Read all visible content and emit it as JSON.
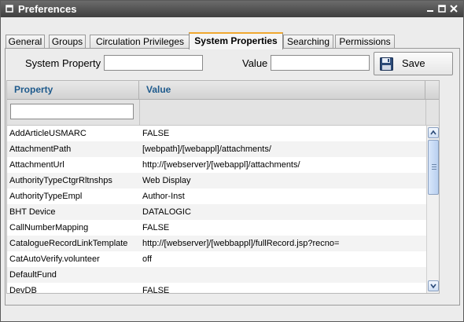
{
  "window": {
    "title": "Preferences"
  },
  "tabs": [
    {
      "label": "General"
    },
    {
      "label": "Groups"
    },
    {
      "label": "Circulation Privileges"
    },
    {
      "label": "System Properties",
      "active": true
    },
    {
      "label": "Searching"
    },
    {
      "label": "Permissions"
    }
  ],
  "form": {
    "system_property_label": "System Property",
    "system_property_value": "",
    "value_label": "Value",
    "value_value": "",
    "save_label": "Save"
  },
  "grid": {
    "columns": {
      "property": "Property",
      "value": "Value"
    },
    "filter_value": "",
    "rows": [
      {
        "property": "AddArticleUSMARC",
        "value": "FALSE"
      },
      {
        "property": "AttachmentPath",
        "value": "[webpath]/[webappl]/attachments/"
      },
      {
        "property": "AttachmentUrl",
        "value": "http://[webserver]/[webappl]/attachments/"
      },
      {
        "property": "AuthorityTypeCtgrRltnshps",
        "value": "Web Display"
      },
      {
        "property": "AuthorityTypeEmpl",
        "value": "Author-Inst"
      },
      {
        "property": "BHT Device",
        "value": "DATALOGIC"
      },
      {
        "property": "CallNumberMapping",
        "value": "FALSE"
      },
      {
        "property": "CatalogueRecordLinkTemplate",
        "value": "http://[webserver]/[webbappl]/fullRecord.jsp?recno="
      },
      {
        "property": "CatAutoVerify.volunteer",
        "value": "off"
      },
      {
        "property": "DefaultFund",
        "value": ""
      },
      {
        "property": "DevDB",
        "value": "FALSE"
      }
    ]
  },
  "icons": {
    "window": "window-icon",
    "minimize": "minimize-icon",
    "maximize": "maximize-icon",
    "close": "close-icon",
    "save": "floppy-disk-icon",
    "scroll_up": "chevron-up-icon",
    "scroll_down": "chevron-down-icon"
  },
  "colors": {
    "header_text": "#1e5a8c",
    "active_tab_accent": "#f0a830",
    "titlebar": "#4a4a4a"
  }
}
